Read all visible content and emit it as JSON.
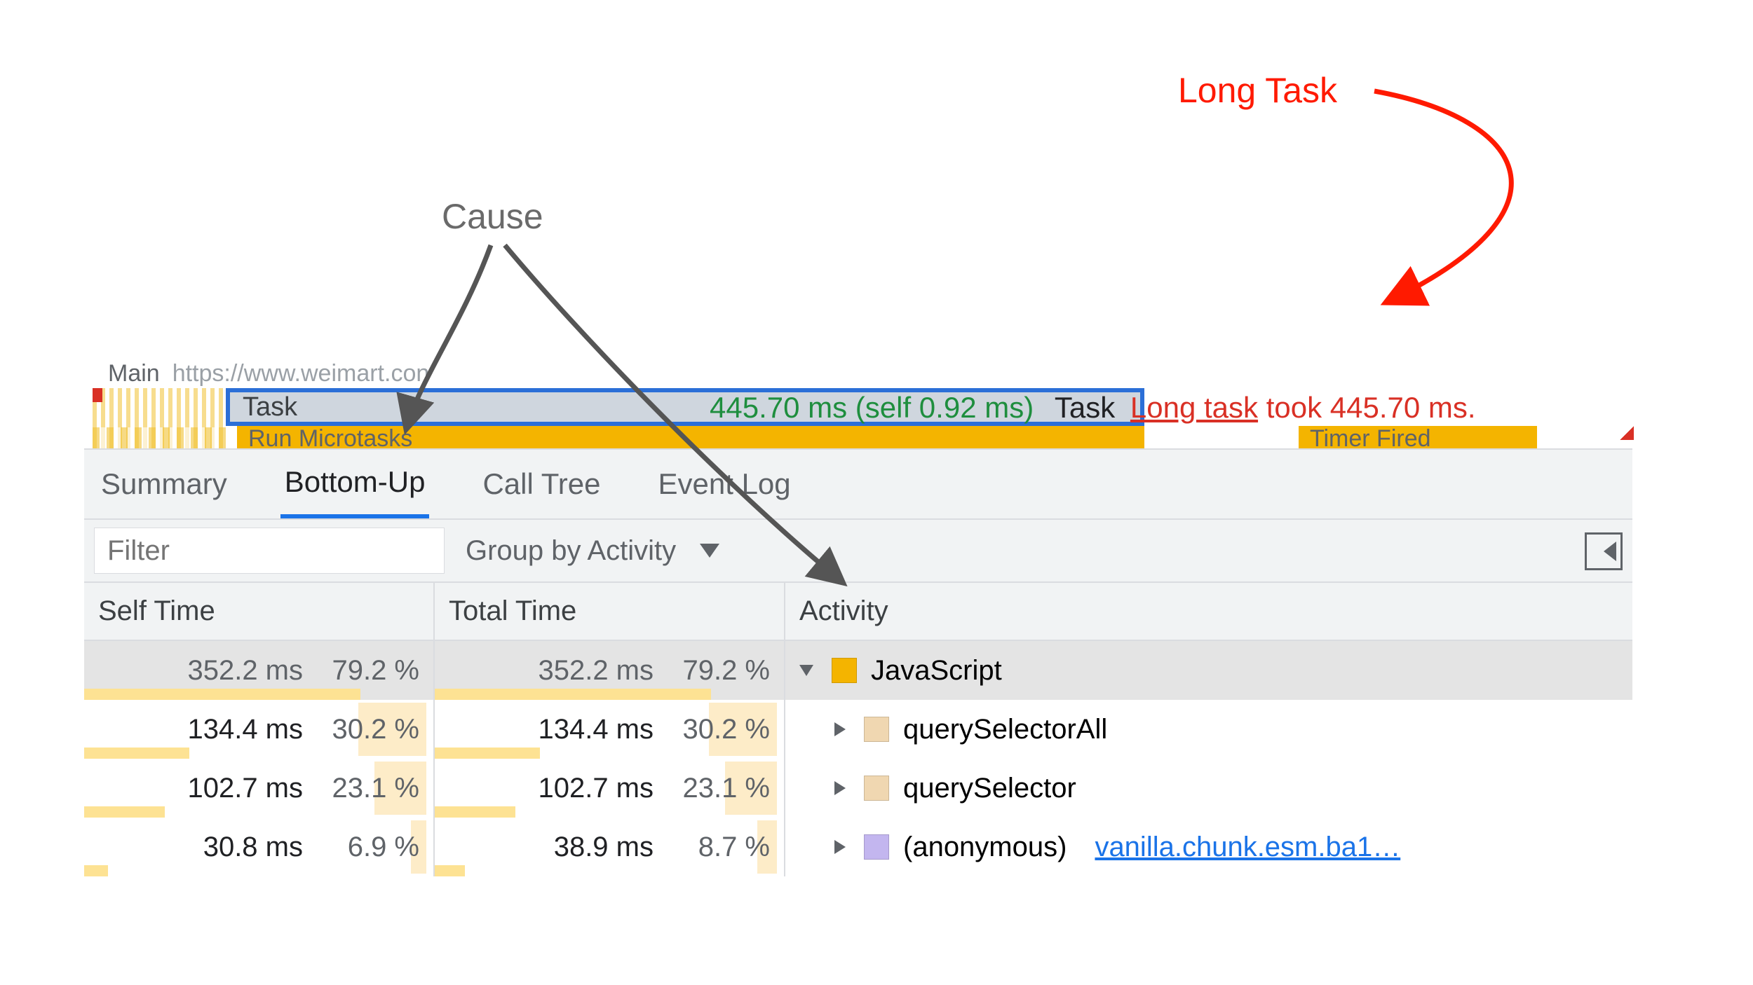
{
  "annotations": {
    "long_task": "Long Task",
    "cause": "Cause"
  },
  "flame": {
    "track_prefix": "Main",
    "track_url_trunc": "https://www.weimart.con",
    "task_label": "Task",
    "tooltip_duration": "445.70 ms",
    "tooltip_self": "(self 0.92 ms)",
    "tooltip_task": "Task",
    "tooltip_long_prefix": "Long task",
    "tooltip_long_rest": " took 445.70 ms.",
    "microtasks_trunc": "Run Microtasks",
    "timer_trunc": "Timer Fired"
  },
  "tabs": {
    "summary": "Summary",
    "bottom_up": "Bottom-Up",
    "call_tree": "Call Tree",
    "event_log": "Event Log",
    "active": "bottom_up"
  },
  "filter": {
    "placeholder": "Filter",
    "group_by": "Group by Activity"
  },
  "columns": {
    "self_time": "Self Time",
    "total_time": "Total Time",
    "activity": "Activity"
  },
  "rows": [
    {
      "self_ms": "352.2 ms",
      "self_pct": "79.2 %",
      "total_ms": "352.2 ms",
      "total_pct": "79.2 %",
      "activity": "JavaScript",
      "swatch": "sw-js",
      "expanded": true,
      "selected": true,
      "depth": 0,
      "self_bar_pct": 79.2,
      "total_bar_pct": 79.2
    },
    {
      "self_ms": "134.4 ms",
      "self_pct": "30.2 %",
      "total_ms": "134.4 ms",
      "total_pct": "30.2 %",
      "activity": "querySelectorAll",
      "swatch": "sw-qs",
      "expanded": false,
      "selected": false,
      "depth": 1,
      "self_bar_pct": 30.2,
      "total_bar_pct": 30.2
    },
    {
      "self_ms": "102.7 ms",
      "self_pct": "23.1 %",
      "total_ms": "102.7 ms",
      "total_pct": "23.1 %",
      "activity": "querySelector",
      "swatch": "sw-qs",
      "expanded": false,
      "selected": false,
      "depth": 1,
      "self_bar_pct": 23.1,
      "total_bar_pct": 23.1
    },
    {
      "self_ms": "30.8 ms",
      "self_pct": "6.9 %",
      "total_ms": "38.9 ms",
      "total_pct": "8.7 %",
      "activity": "(anonymous)",
      "swatch": "sw-anon",
      "expanded": false,
      "selected": false,
      "depth": 1,
      "link": "vanilla.chunk.esm.ba1…",
      "self_bar_pct": 6.9,
      "total_bar_pct": 8.7
    }
  ]
}
